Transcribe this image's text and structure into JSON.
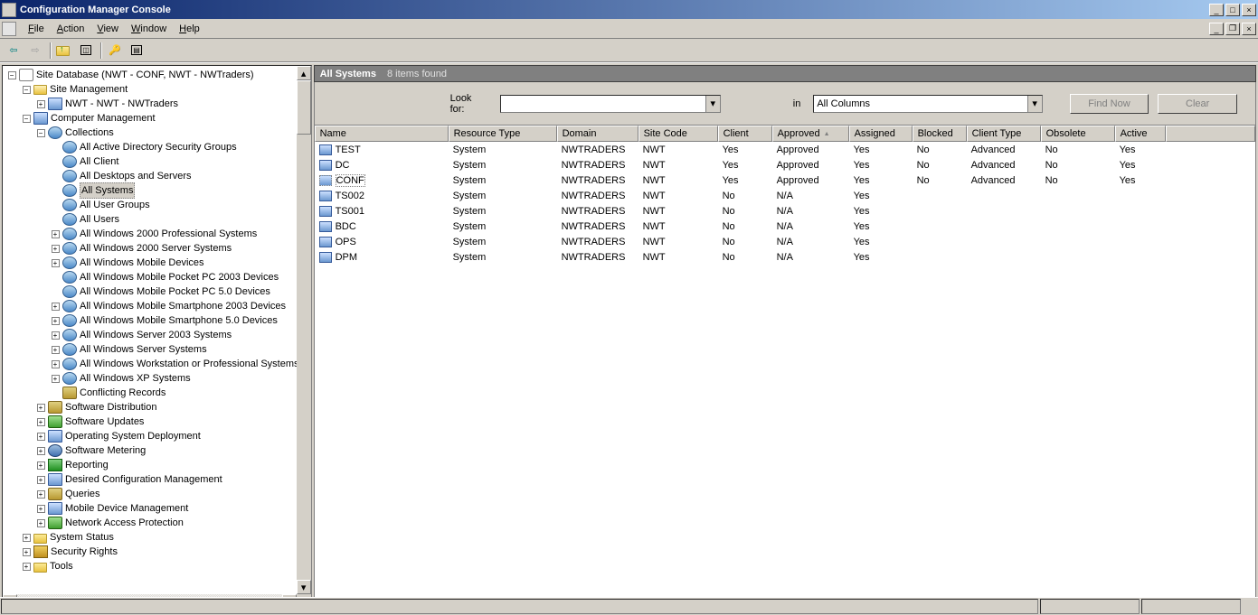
{
  "window": {
    "title": "Configuration Manager Console"
  },
  "menus": [
    "File",
    "Action",
    "View",
    "Window",
    "Help"
  ],
  "tree": {
    "root": "Site Database  (NWT - CONF, NWT - NWTraders)",
    "site_management": "Site Management",
    "nwt_site": "NWT - NWT - NWTraders",
    "computer_management": "Computer Management",
    "collections": "Collections",
    "collection_items": [
      "All Active Directory Security Groups",
      "All Client",
      "All Desktops and Servers",
      "All Systems",
      "All User Groups",
      "All Users",
      "All Windows 2000 Professional Systems",
      "All Windows 2000 Server Systems",
      "All Windows Mobile Devices",
      "All Windows Mobile Pocket PC 2003 Devices",
      "All Windows Mobile Pocket PC 5.0 Devices",
      "All Windows Mobile Smartphone 2003 Devices",
      "All Windows Mobile Smartphone 5.0 Devices",
      "All Windows Server 2003 Systems",
      "All Windows Server Systems",
      "All Windows Workstation or Professional Systems",
      "All Windows XP Systems"
    ],
    "conflicting": "Conflicting Records",
    "software_distribution": "Software Distribution",
    "software_updates": "Software Updates",
    "os_deployment": "Operating System Deployment",
    "software_metering": "Software Metering",
    "reporting": "Reporting",
    "dcm": "Desired Configuration Management",
    "queries": "Queries",
    "mdm": "Mobile Device Management",
    "nap": "Network Access Protection",
    "system_status": "System Status",
    "security_rights": "Security Rights",
    "tools": "Tools"
  },
  "content": {
    "title": "All Systems",
    "count": "8 items found",
    "look_for_label": "Look for:",
    "in_label": "in",
    "in_value": "All Columns",
    "find_now": "Find Now",
    "clear": "Clear"
  },
  "columns": [
    "Name",
    "Resource Type",
    "Domain",
    "Site Code",
    "Client",
    "Approved",
    "Assigned",
    "Blocked",
    "Client Type",
    "Obsolete",
    "Active"
  ],
  "sort_col": "Approved",
  "rows": [
    {
      "name": "TEST",
      "rtype": "System",
      "domain": "NWTRADERS",
      "site": "NWT",
      "client": "Yes",
      "approved": "Approved",
      "assigned": "Yes",
      "blocked": "No",
      "ctype": "Advanced",
      "obsolete": "No",
      "active": "Yes"
    },
    {
      "name": "DC",
      "rtype": "System",
      "domain": "NWTRADERS",
      "site": "NWT",
      "client": "Yes",
      "approved": "Approved",
      "assigned": "Yes",
      "blocked": "No",
      "ctype": "Advanced",
      "obsolete": "No",
      "active": "Yes"
    },
    {
      "name": "CONF",
      "rtype": "System",
      "domain": "NWTRADERS",
      "site": "NWT",
      "client": "Yes",
      "approved": "Approved",
      "assigned": "Yes",
      "blocked": "No",
      "ctype": "Advanced",
      "obsolete": "No",
      "active": "Yes"
    },
    {
      "name": "TS002",
      "rtype": "System",
      "domain": "NWTRADERS",
      "site": "NWT",
      "client": "No",
      "approved": "N/A",
      "assigned": "Yes",
      "blocked": "",
      "ctype": "",
      "obsolete": "",
      "active": ""
    },
    {
      "name": "TS001",
      "rtype": "System",
      "domain": "NWTRADERS",
      "site": "NWT",
      "client": "No",
      "approved": "N/A",
      "assigned": "Yes",
      "blocked": "",
      "ctype": "",
      "obsolete": "",
      "active": ""
    },
    {
      "name": "BDC",
      "rtype": "System",
      "domain": "NWTRADERS",
      "site": "NWT",
      "client": "No",
      "approved": "N/A",
      "assigned": "Yes",
      "blocked": "",
      "ctype": "",
      "obsolete": "",
      "active": ""
    },
    {
      "name": "OPS",
      "rtype": "System",
      "domain": "NWTRADERS",
      "site": "NWT",
      "client": "No",
      "approved": "N/A",
      "assigned": "Yes",
      "blocked": "",
      "ctype": "",
      "obsolete": "",
      "active": ""
    },
    {
      "name": "DPM",
      "rtype": "System",
      "domain": "NWTRADERS",
      "site": "NWT",
      "client": "No",
      "approved": "N/A",
      "assigned": "Yes",
      "blocked": "",
      "ctype": "",
      "obsolete": "",
      "active": ""
    }
  ]
}
